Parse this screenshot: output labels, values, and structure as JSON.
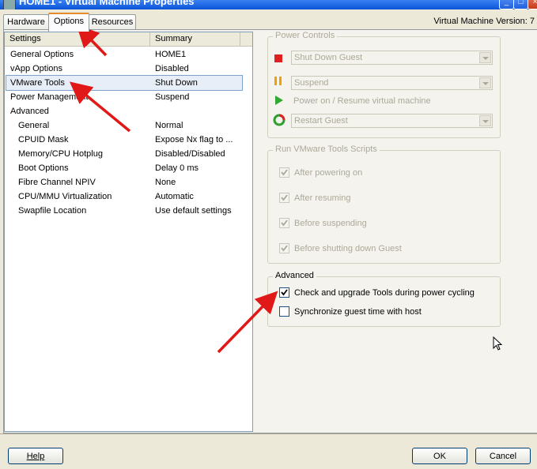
{
  "window": {
    "title": "HOME1 - Virtual Machine Properties"
  },
  "tabs": [
    {
      "label": "Hardware"
    },
    {
      "label": "Options"
    },
    {
      "label": "Resources"
    }
  ],
  "version_label": "Virtual Machine Version: 7",
  "settings_list": {
    "columns": [
      "Settings",
      "Summary"
    ],
    "rows": [
      {
        "setting": "General Options",
        "summary": "HOME1"
      },
      {
        "setting": "vApp Options",
        "summary": "Disabled"
      },
      {
        "setting": "VMware Tools",
        "summary": "Shut Down"
      },
      {
        "setting": "Power Management",
        "summary": "Suspend"
      },
      {
        "setting": "Advanced",
        "summary": ""
      },
      {
        "setting": "General",
        "summary": "Normal"
      },
      {
        "setting": "CPUID Mask",
        "summary": "Expose Nx flag to ..."
      },
      {
        "setting": "Memory/CPU Hotplug",
        "summary": "Disabled/Disabled"
      },
      {
        "setting": "Boot Options",
        "summary": "Delay 0 ms"
      },
      {
        "setting": "Fibre Channel NPIV",
        "summary": "None"
      },
      {
        "setting": "CPU/MMU Virtualization",
        "summary": "Automatic"
      },
      {
        "setting": "Swapfile Location",
        "summary": "Use default settings"
      }
    ]
  },
  "power_controls": {
    "legend": "Power Controls",
    "shutdown": "Shut Down Guest",
    "suspend": "Suspend",
    "power_on": "Power on / Resume virtual machine",
    "restart": "Restart Guest"
  },
  "tools_scripts": {
    "legend": "Run VMware Tools Scripts",
    "items": [
      "After powering on",
      "After resuming",
      "Before suspending",
      "Before shutting down Guest"
    ]
  },
  "advanced": {
    "legend": "Advanced",
    "check_upgrade": "Check and upgrade Tools during power cycling",
    "sync_time": "Synchronize guest time with host"
  },
  "buttons": {
    "help": "Help",
    "ok": "OK",
    "cancel": "Cancel"
  },
  "colors": {
    "arrow": "#e01818",
    "title_bar": "#0a55d8",
    "tab_highlight": "#e68b2c"
  }
}
